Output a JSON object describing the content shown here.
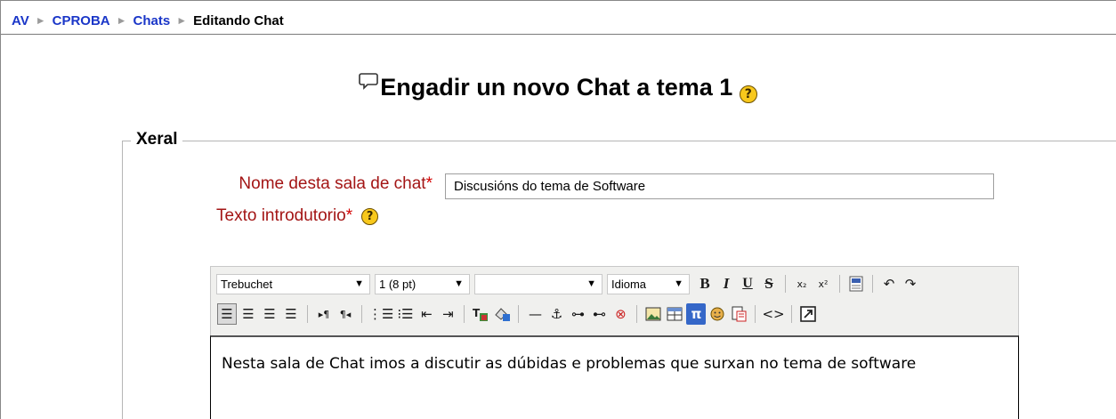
{
  "breadcrumb": {
    "items": [
      "AV",
      "CPROBA",
      "Chats"
    ],
    "current": "Editando Chat",
    "separator": "►"
  },
  "page": {
    "title": "Engadir un novo Chat a tema 1"
  },
  "form": {
    "section_title": "Xeral",
    "name_label": "Nome desta sala de chat",
    "name_value": "Discusións do tema de Software",
    "intro_label": "Texto introdutorio",
    "required_mark": "*",
    "intro_text": "Nesta sala de Chat imos a discutir as dúbidas e problemas que surxan no tema de software"
  },
  "editor": {
    "font_select": "Trebuchet",
    "size_select": "1 (8 pt)",
    "format_select": "",
    "language_select": "Idioma",
    "icons_row1": [
      "bold",
      "italic",
      "underline",
      "strikethrough",
      "subscript",
      "superscript",
      "paste-from-word",
      "undo",
      "redo"
    ],
    "icons_row2": [
      "align-left",
      "align-center",
      "align-right",
      "justify",
      "ltr",
      "rtl",
      "ordered-list",
      "unordered-list",
      "outdent",
      "indent",
      "text-color",
      "background-color",
      "horizontal-rule",
      "anchor",
      "link",
      "unlink",
      "no-link",
      "image",
      "table",
      "math",
      "emoticon",
      "find",
      "html-source",
      "fullscreen"
    ]
  },
  "colors": {
    "link": "#1a36c8",
    "required_label": "#a31515",
    "help_icon": "#f8c81c"
  }
}
